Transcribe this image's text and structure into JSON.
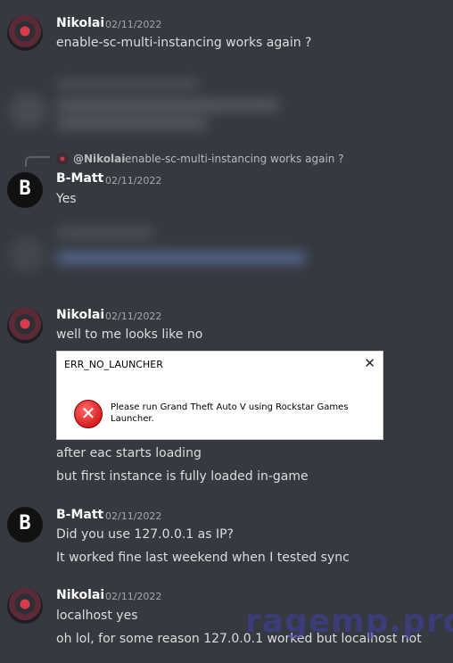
{
  "messages": [
    {
      "author": "Nikolai",
      "timestamp": "02/11/2022",
      "lines": [
        "enable-sc-multi-instancing works again ?"
      ]
    },
    {
      "reply": {
        "name": "@Nikolai",
        "text": "enable-sc-multi-instancing works again ?"
      },
      "author": "B-Matt",
      "timestamp": "02/11/2022",
      "lines": [
        "Yes"
      ]
    },
    {
      "author": "Nikolai",
      "timestamp": "02/11/2022",
      "lines": [
        "well to me looks like no"
      ],
      "after_dialog": [
        "after eac starts loading",
        "but first instance is fully loaded in-game"
      ]
    },
    {
      "author": "B-Matt",
      "timestamp": "02/11/2022",
      "lines": [
        "Did you use 127.0.0.1 as IP?",
        "It worked fine last weekend when I tested sync"
      ]
    },
    {
      "author": "Nikolai",
      "timestamp": "02/11/2022",
      "lines": [
        "localhost yes",
        "oh lol, for some reason 127.0.0.1 worked but localhost not"
      ]
    }
  ],
  "dialog": {
    "title": "ERR_NO_LAUNCHER",
    "close": "✕",
    "icon_text": "✕",
    "message": "Please run Grand Theft Auto V using Rockstar Games Launcher."
  },
  "avatar_glyph": "B",
  "watermark": "ragemp.pro",
  "colors": {
    "background": "#36393f",
    "text": "#dcddde",
    "username": "#ffffff",
    "timestamp": "#a3a6aa",
    "watermark": "#4040a8"
  }
}
